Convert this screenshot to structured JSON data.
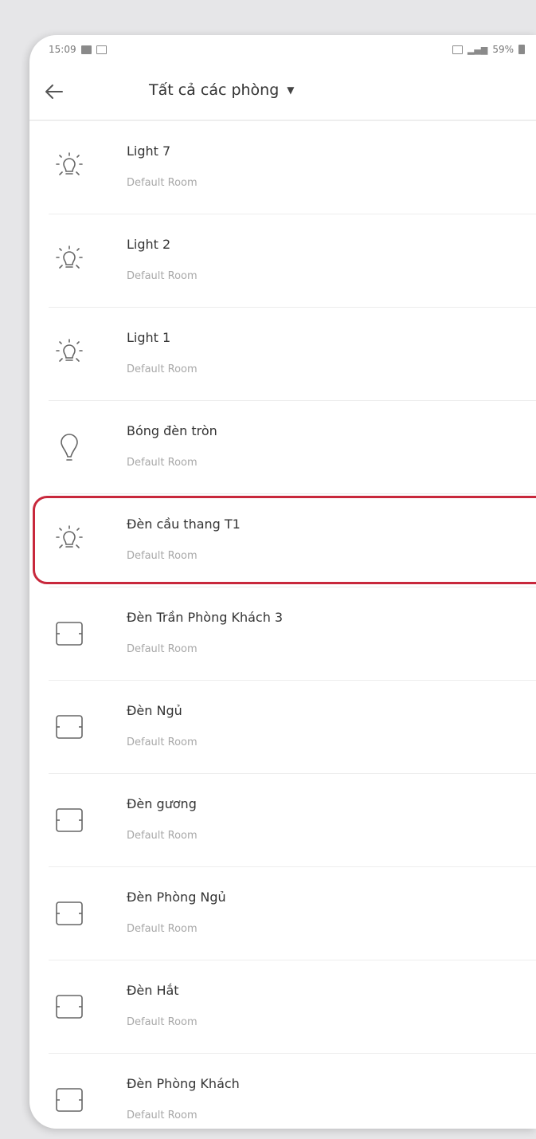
{
  "status_bar": {
    "time": "15:09",
    "right_text": "59%"
  },
  "header": {
    "title": "Tất cả các phòng",
    "dropdown_caret": "▼"
  },
  "devices": [
    {
      "name": "Light 7",
      "room": "Default Room",
      "icon": "light-bulb-icon"
    },
    {
      "name": "Light 2",
      "room": "Default Room",
      "icon": "light-bulb-icon"
    },
    {
      "name": "Light 1",
      "room": "Default Room",
      "icon": "light-bulb-icon"
    },
    {
      "name": "Bóng đèn tròn",
      "room": "Default Room",
      "icon": "round-bulb-icon"
    },
    {
      "name": "Đèn cầu thang T1",
      "room": "Default Room",
      "icon": "light-bulb-icon"
    },
    {
      "name": "Đèn Trần Phòng Khách 3",
      "room": "Default Room",
      "icon": "switch-panel-icon"
    },
    {
      "name": "Đèn Ngủ",
      "room": "Default Room",
      "icon": "switch-panel-icon"
    },
    {
      "name": "Đèn gương",
      "room": "Default Room",
      "icon": "switch-panel-icon"
    },
    {
      "name": "Đèn Phòng Ngủ",
      "room": "Default Room",
      "icon": "switch-panel-icon"
    },
    {
      "name": "Đèn Hắt",
      "room": "Default Room",
      "icon": "switch-panel-icon"
    },
    {
      "name": "Đèn Phòng Khách",
      "room": "Default Room",
      "icon": "switch-panel-icon"
    }
  ],
  "highlighted_device": "Đèn cầu thang T1",
  "colors": {
    "highlight_border": "#c8283c",
    "room_text": "#a8a8a8"
  }
}
